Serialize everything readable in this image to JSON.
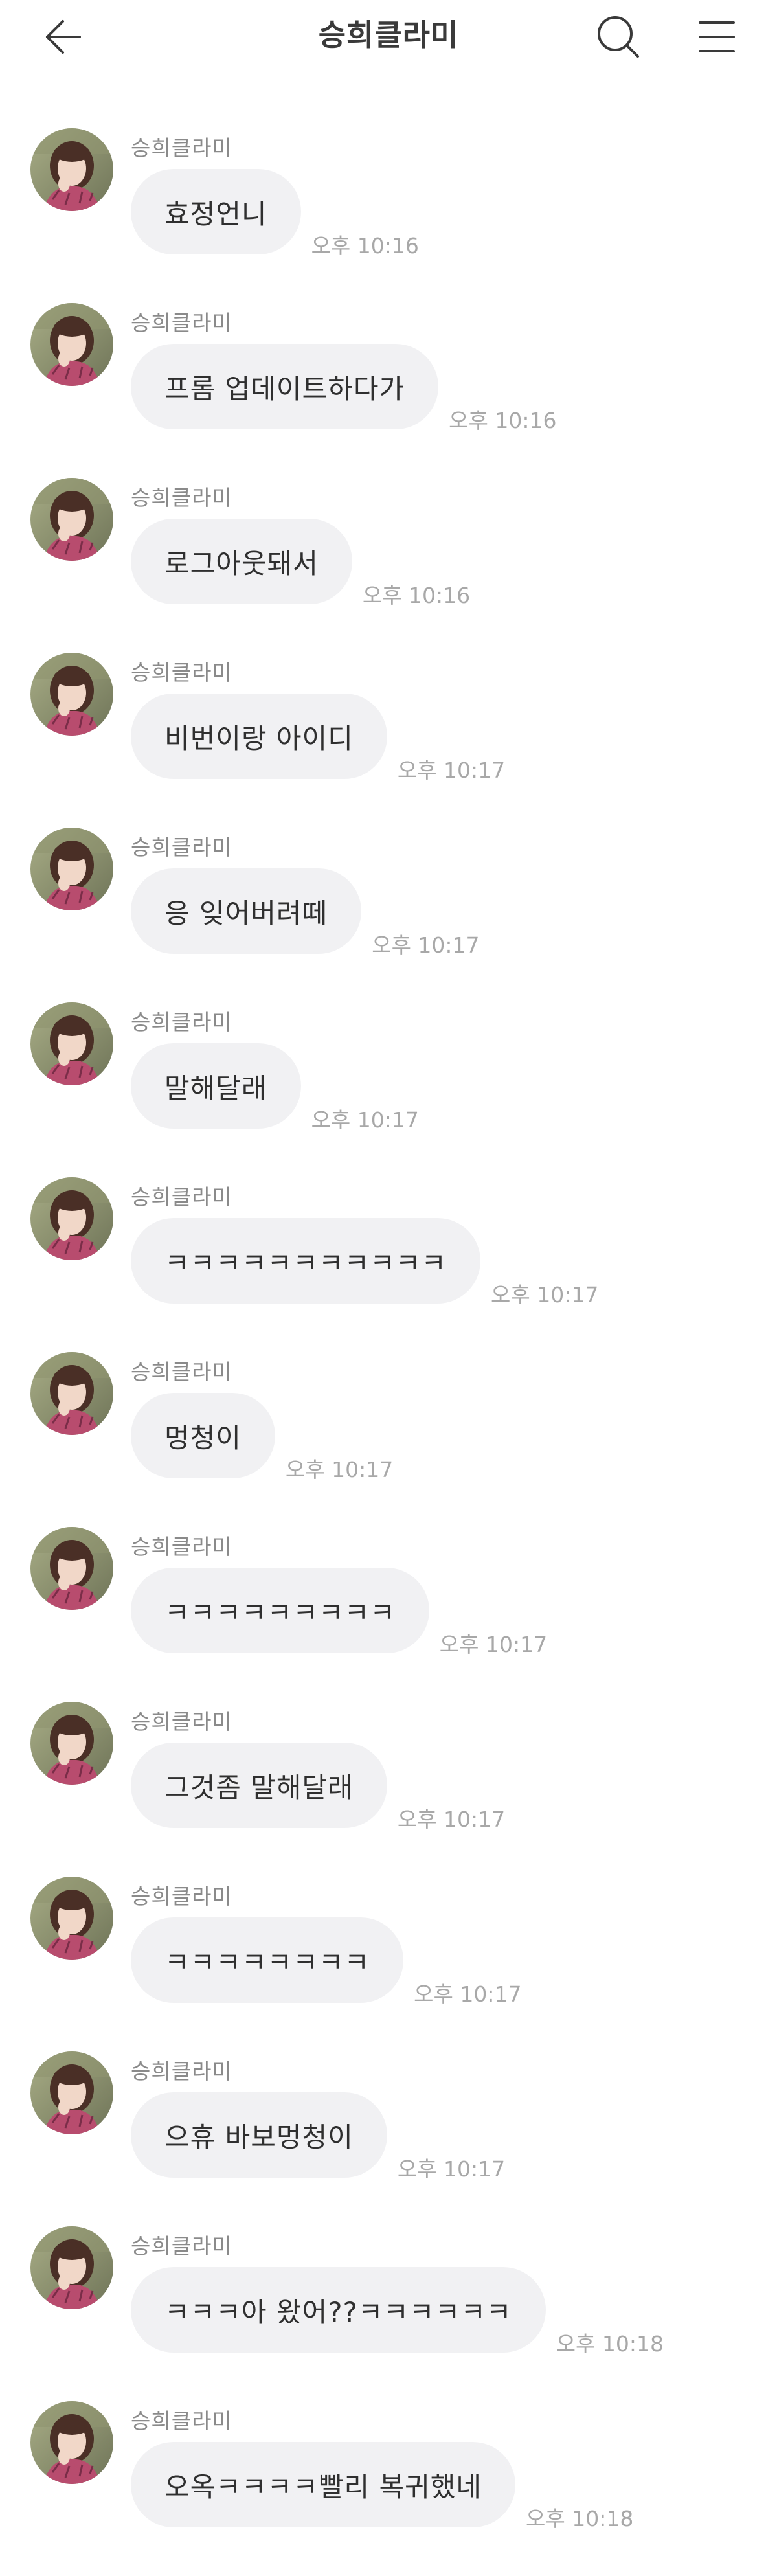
{
  "header": {
    "title": "승희클라미"
  },
  "messages": [
    {
      "sender": "승희클라미",
      "text": "효정언니",
      "time": "오후 10:16"
    },
    {
      "sender": "승희클라미",
      "text": "프롬 업데이트하다가",
      "time": "오후 10:16"
    },
    {
      "sender": "승희클라미",
      "text": "로그아웃돼서",
      "time": "오후 10:16"
    },
    {
      "sender": "승희클라미",
      "text": "비번이랑 아이디",
      "time": "오후 10:17"
    },
    {
      "sender": "승희클라미",
      "text": "응 잊어버려떼",
      "time": "오후 10:17"
    },
    {
      "sender": "승희클라미",
      "text": "말해달래",
      "time": "오후 10:17"
    },
    {
      "sender": "승희클라미",
      "text": "ㅋㅋㅋㅋㅋㅋㅋㅋㅋㅋㅋ",
      "time": "오후 10:17"
    },
    {
      "sender": "승희클라미",
      "text": "멍청이",
      "time": "오후 10:17"
    },
    {
      "sender": "승희클라미",
      "text": "ㅋㅋㅋㅋㅋㅋㅋㅋㅋ",
      "time": "오후 10:17"
    },
    {
      "sender": "승희클라미",
      "text": "그것좀 말해달래",
      "time": "오후 10:17"
    },
    {
      "sender": "승희클라미",
      "text": "ㅋㅋㅋㅋㅋㅋㅋㅋ",
      "time": "오후 10:17"
    },
    {
      "sender": "승희클라미",
      "text": "으휴 바보멍청이",
      "time": "오후 10:17"
    },
    {
      "sender": "승희클라미",
      "text": "ㅋㅋㅋ아 왔어??ㅋㅋㅋㅋㅋㅋ",
      "time": "오후 10:18"
    },
    {
      "sender": "승희클라미",
      "text": "오옥ㅋㅋㅋㅋ빨리 복귀했네",
      "time": "오후 10:18"
    }
  ]
}
